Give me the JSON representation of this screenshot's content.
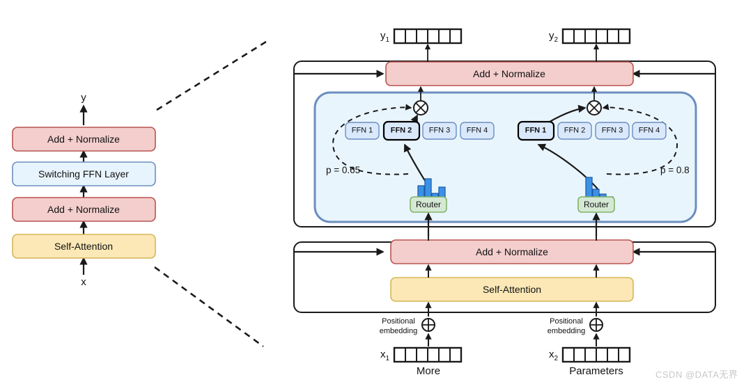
{
  "left_diagram": {
    "output_var": "y",
    "input_var": "x",
    "blocks": [
      {
        "label": "Add + Normalize",
        "kind": "addnorm"
      },
      {
        "label": "Switching FFN Layer",
        "kind": "switching"
      },
      {
        "label": "Add + Normalize",
        "kind": "addnorm"
      },
      {
        "label": "Self-Attention",
        "kind": "attention"
      }
    ]
  },
  "right_diagram": {
    "top_addnorm_label": "Add + Normalize",
    "bottom_addnorm_label": "Add + Normalize",
    "self_attention_label": "Self-Attention",
    "outputs": [
      {
        "var": "y",
        "sub": "1"
      },
      {
        "var": "y",
        "sub": "2"
      }
    ],
    "inputs": [
      {
        "var": "x",
        "sub": "1",
        "word": "More",
        "positional_label": "Positional\nembedding"
      },
      {
        "var": "x",
        "sub": "2",
        "word": "Parameters",
        "positional_label": "Positional\nembedding"
      }
    ],
    "token_cells": 6,
    "experts": {
      "left": {
        "router_label": "Router",
        "probability_label": "p = 0.65",
        "selected_index": 1,
        "ffns": [
          "FFN 1",
          "FFN 2",
          "FFN 3",
          "FFN 4"
        ],
        "router_distribution": [
          0.42,
          0.65,
          0.18,
          0.38
        ]
      },
      "right": {
        "router_label": "Router",
        "probability_label": "p = 0.8",
        "selected_index": 0,
        "ffns": [
          "FFN 1",
          "FFN 2",
          "FFN 3",
          "FFN 4"
        ],
        "router_distribution": [
          0.8,
          0.32,
          0.15,
          0.04
        ]
      }
    }
  },
  "watermark": "CSDN @DATA无界",
  "colors": {
    "addnorm_fill": "#f3cecd",
    "addnorm_stroke": "#b85450",
    "switching_fill": "#e8f4fd",
    "switching_stroke": "#6c8ebf",
    "attention_fill": "#fbe8b6",
    "attention_stroke": "#d6b656",
    "ffn_fill": "#dae8fc",
    "ffn_stroke": "#6c8ebf",
    "ffn_selected_stroke": "#000000",
    "router_fill": "#d5e8d4",
    "router_stroke": "#82b366",
    "moe_panel_fill": "#e9f5fd",
    "moe_panel_stroke": "#6c8ebf",
    "bar_fill": "#3c91e6",
    "bar_stroke": "#1f5fa8",
    "line": "#1a1a1a",
    "watermark": "#c8c8c8"
  }
}
